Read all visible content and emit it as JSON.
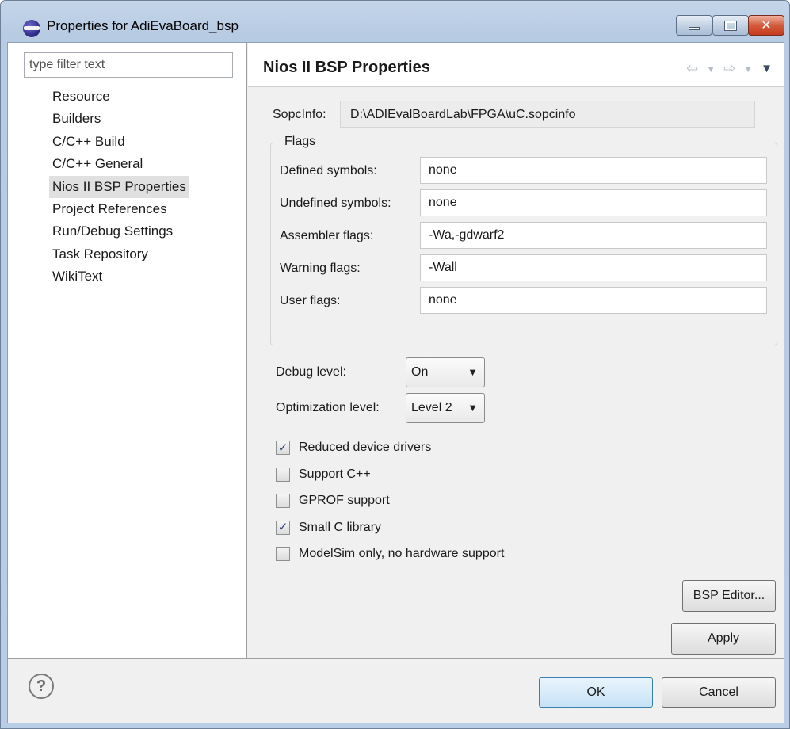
{
  "window": {
    "title": "Properties for AdiEvaBoard_bsp"
  },
  "sidebar": {
    "filter_placeholder": "type filter text",
    "items": [
      {
        "label": "Resource"
      },
      {
        "label": "Builders"
      },
      {
        "label": "C/C++ Build"
      },
      {
        "label": "C/C++ General"
      },
      {
        "label": "Nios II BSP Properties",
        "selected": true
      },
      {
        "label": "Project References"
      },
      {
        "label": "Run/Debug Settings"
      },
      {
        "label": "Task Repository"
      },
      {
        "label": "WikiText"
      }
    ]
  },
  "page": {
    "title": "Nios II BSP Properties",
    "sopcinfo": {
      "label": "SopcInfo:",
      "value": "D:\\ADIEvalBoardLab\\FPGA\\uC.sopcinfo"
    },
    "flags": {
      "legend": "Flags",
      "rows": [
        {
          "label": "Defined symbols:",
          "value": "none"
        },
        {
          "label": "Undefined symbols:",
          "value": "none"
        },
        {
          "label": "Assembler flags:",
          "value": "-Wa,-gdwarf2"
        },
        {
          "label": "Warning flags:",
          "value": "-Wall"
        },
        {
          "label": "User flags:",
          "value": "none"
        }
      ]
    },
    "debug_level": {
      "label": "Debug level:",
      "value": "On"
    },
    "optimization_level": {
      "label": "Optimization level:",
      "value": "Level 2"
    },
    "checkboxes": [
      {
        "label": "Reduced device drivers",
        "checked": true
      },
      {
        "label": "Support C++",
        "checked": false
      },
      {
        "label": "GPROF support",
        "checked": false
      },
      {
        "label": "Small C library",
        "checked": true
      },
      {
        "label": "ModelSim only, no hardware support",
        "checked": false
      }
    ],
    "bsp_editor_label": "BSP Editor...",
    "apply_label": "Apply"
  },
  "footer": {
    "help_glyph": "?",
    "ok_label": "OK",
    "cancel_label": "Cancel"
  },
  "icons": {
    "back": "back-arrow-icon",
    "forward": "forward-arrow-icon",
    "menu": "view-menu-icon",
    "help": "help-icon",
    "app": "eclipse-icon",
    "check_glyph": "✓"
  },
  "colors": {
    "titlebar": "#c5d6ea",
    "close_button": "#d45a3c",
    "ok_button_border": "#3c7fb1"
  }
}
